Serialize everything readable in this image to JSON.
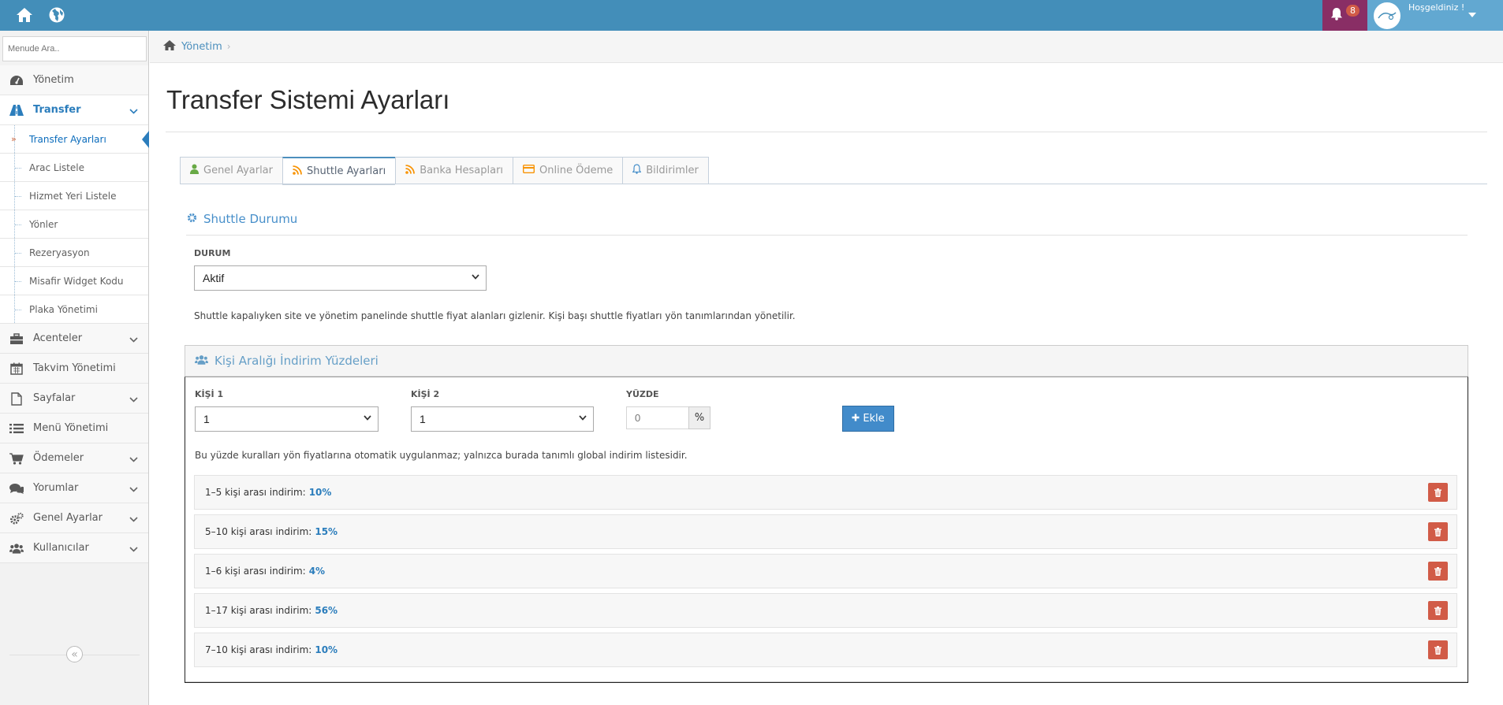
{
  "topbar": {
    "notification_count": "8",
    "welcome": "Hoşgeldiniz !"
  },
  "sidebar": {
    "search_placeholder": "Menude Ara..",
    "items": [
      {
        "label": "Yönetim"
      },
      {
        "label": "Transfer"
      },
      {
        "label": "Acenteler"
      },
      {
        "label": "Takvim Yönetimi"
      },
      {
        "label": "Sayfalar"
      },
      {
        "label": "Menü Yönetimi"
      },
      {
        "label": "Ödemeler"
      },
      {
        "label": "Yorumlar"
      },
      {
        "label": "Genel Ayarlar"
      },
      {
        "label": "Kullanıcılar"
      }
    ],
    "transfer_sub": [
      {
        "label": "Transfer Ayarları"
      },
      {
        "label": "Arac Listele"
      },
      {
        "label": "Hizmet Yeri Listele"
      },
      {
        "label": "Yönler"
      },
      {
        "label": "Rezeryasyon"
      },
      {
        "label": "Misafir Widget Kodu"
      },
      {
        "label": "Plaka Yönetimi"
      }
    ],
    "collapse_glyph": "«"
  },
  "breadcrumb": {
    "home": "Yönetim"
  },
  "page": {
    "title": "Transfer Sistemi Ayarları"
  },
  "tabs": [
    {
      "label": "Genel Ayarlar"
    },
    {
      "label": "Shuttle Ayarları"
    },
    {
      "label": "Banka Hesapları"
    },
    {
      "label": "Online Ödeme"
    },
    {
      "label": "Bildirimler"
    }
  ],
  "shuttle": {
    "section_title": "Shuttle Durumu",
    "status_label": "DURUM",
    "status_value": "Aktif",
    "help": "Shuttle kapalıyken site ve yönetim panelinde shuttle fiyat alanları gizlenir. Kişi başı shuttle fiyatları yön tanımlarından yönetilir."
  },
  "discount": {
    "title": "Kişi Aralığı İndirim Yüzdeleri",
    "kisi1_label": "KİŞİ 1",
    "kisi1_value": "1",
    "kisi2_label": "KİŞİ 2",
    "kisi2_value": "1",
    "yuzde_label": "YÜZDE",
    "yuzde_placeholder": "0",
    "percent_addon": "%",
    "add_label": "Ekle",
    "note": "Bu yüzde kuralları yön fiyatlarına otomatik uygulanmaz; yalnızca burada tanımlı global indirim listesidir.",
    "rules": [
      {
        "text": "1–5 kişi arası indirim:",
        "pct": "10%"
      },
      {
        "text": "5–10 kişi arası indirim:",
        "pct": "15%"
      },
      {
        "text": "1–6 kişi arası indirim:",
        "pct": "4%"
      },
      {
        "text": "1–17 kişi arası indirim:",
        "pct": "56%"
      },
      {
        "text": "7–10 kişi arası indirim:",
        "pct": "10%"
      }
    ]
  },
  "colors": {
    "navbar": "#438eb9",
    "accent": "#2b7dbc",
    "danger": "#d15b47",
    "primary_button": "#428bca"
  }
}
